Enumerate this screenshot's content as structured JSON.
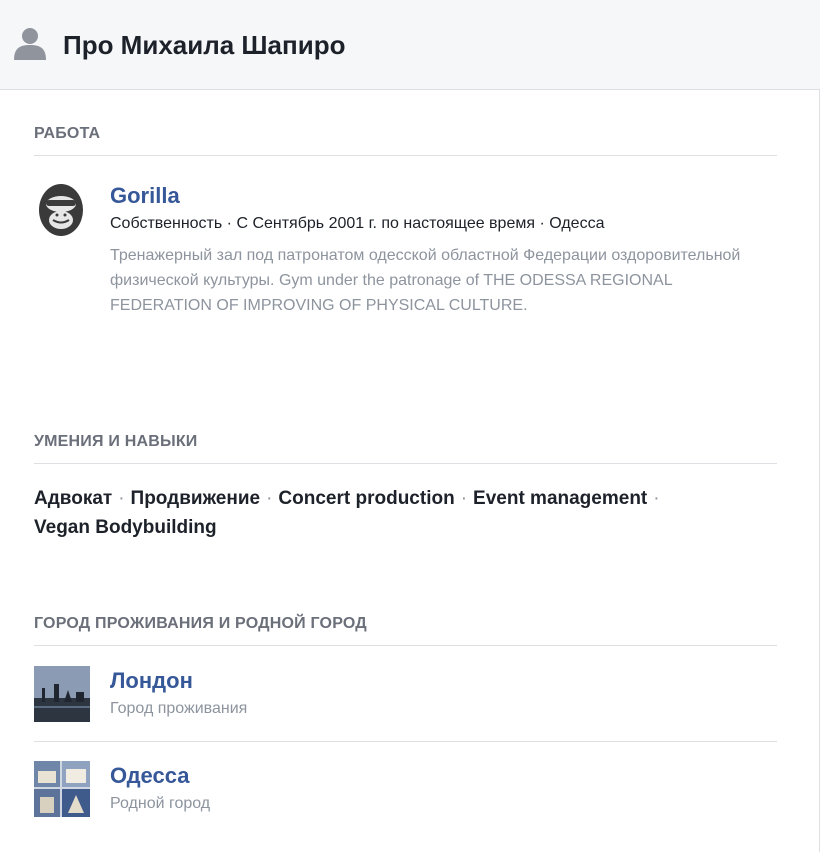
{
  "header": {
    "title": "Про Михаила Шапиро",
    "icon": "user-silhouette-icon"
  },
  "work": {
    "section_title": "РАБОТА",
    "items": [
      {
        "name": "Gorilla",
        "icon": "gorilla-logo-icon",
        "meta": "Собственность · С Сентябрь 2001 г. по настоящее время · Одесса",
        "description": "Тренажерный зал под патронатом одесской областной Федерации оздоровительной физической культуры. Gym under the patronage of THE ODESSA REGIONAL FEDERATION OF IMPROVING OF PHYSICAL CULTURE."
      }
    ]
  },
  "skills": {
    "section_title": "УМЕНИЯ И НАВЫКИ",
    "separator": "·",
    "items": [
      "Адвокат",
      "Продвижение",
      "Concert production",
      "Event management",
      "Vegan Bodybuilding"
    ]
  },
  "places": {
    "section_title": "ГОРОД ПРОЖИВАНИЯ И РОДНОЙ ГОРОД",
    "items": [
      {
        "name": "Лондон",
        "type": "Город проживания",
        "icon": "london-thumbnail"
      },
      {
        "name": "Одесса",
        "type": "Родной город",
        "icon": "odessa-thumbnail"
      }
    ]
  },
  "colors": {
    "link": "#365899",
    "text": "#1d2129",
    "muted": "#8d949e",
    "section": "#6a6f7a",
    "divider": "#dddfe2",
    "header_bg": "#f6f7f9"
  }
}
